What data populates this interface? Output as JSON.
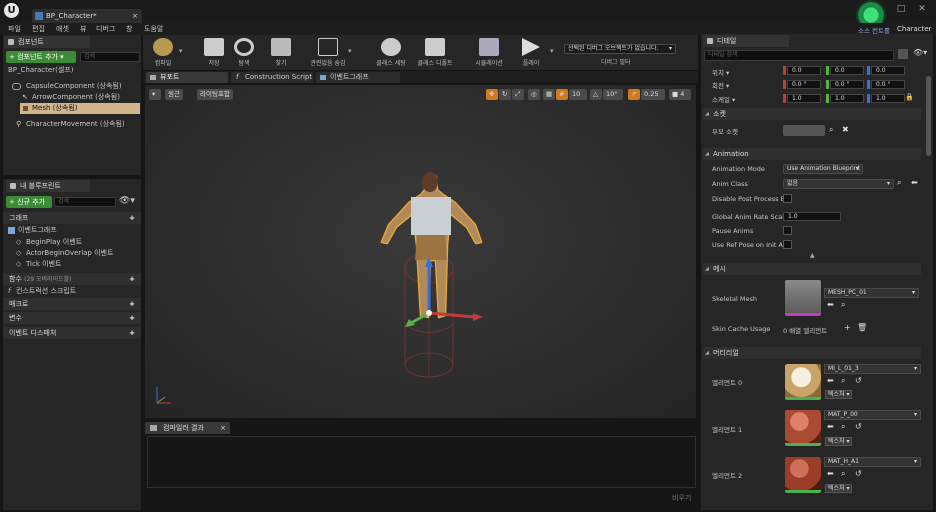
{
  "title_bar": {
    "doc_tab": "BP_Character*",
    "doc_tab_close": "×",
    "logo": "U",
    "source_control": "소스 컨트롤",
    "character": "Character"
  },
  "menu": [
    "파일",
    "편집",
    "애셋",
    "뷰",
    "디버그",
    "창",
    "도움말"
  ],
  "components": {
    "header": "컴포넌트",
    "add_button": "+ 컴포넌트 추가 ▾",
    "search_placeholder": "검색",
    "root": "BP_Character(셀프)",
    "items": [
      "CapsuleComponent (상속됨)",
      "ArrowComponent (상속됨)",
      "Mesh (상속됨)",
      "CharacterMovement (상속됨)"
    ]
  },
  "my_blueprint": {
    "header": "내 블루프린트",
    "add_button": "+ 신규 추가 ▾",
    "search_placeholder": "검색",
    "sections": {
      "graphs": "그래프",
      "event_graph": "이벤트그래프",
      "events": [
        "BeginPlay 이벤트",
        "ActorBeginOverlap 이벤트",
        "Tick 이벤트"
      ],
      "functions": "함수",
      "functions_count": "(29 오버라이드블)",
      "construction_script": "컨스트럭션 스크립트",
      "macros": "매크로",
      "variables": "변수",
      "event_dispatchers": "이벤트 디스패처"
    }
  },
  "toolbar": {
    "buttons": [
      "컴파일",
      "저장",
      "탐색",
      "찾기",
      "관련없음 숨김",
      "클래스 세팅",
      "클래스 디폴트",
      "시뮬레이션",
      "플레이"
    ],
    "debug_dropdown": "선택된 디버그 오브젝트가 없습니다.",
    "debug_filter": "디버그 필터"
  },
  "viewport_tabs": [
    "뷰포트",
    "Construction Script",
    "이벤트그래프"
  ],
  "viewport": {
    "perspective": "원근",
    "lighting": "라이팅포함",
    "grid_snap": "10",
    "rotation_snap": "10°",
    "scale_snap": "0.25",
    "camera_speed": "4"
  },
  "compiler": {
    "tab": "컴파일러 결과",
    "clear": "비우기"
  },
  "details": {
    "header": "디테일",
    "search_placeholder": "디테일 검색",
    "transform": {
      "location_label": "위치 ▾",
      "rotation_label": "회전 ▾",
      "scale_label": "스케일 ▾",
      "location": [
        "0.0",
        "0.0",
        "0.0"
      ],
      "rotation": [
        "0.0 °",
        "0.0 °",
        "0.0 °"
      ],
      "scale": [
        "1.0",
        "1.0",
        "1.0"
      ]
    },
    "sockets": {
      "section": "소켓",
      "parent_socket": "부모 소켓"
    },
    "animation": {
      "section": "Animation",
      "mode_label": "Animation Mode",
      "mode_value": "Use Animation Blueprint",
      "class_label": "Anim Class",
      "class_value": "없음",
      "disable_post_process": "Disable Post Process Bl",
      "global_rate_label": "Global Anim Rate Scale",
      "global_rate_value": "1.0",
      "pause_anims": "Pause Anims",
      "use_ref_pose": "Use Ref Pose on Init Ani"
    },
    "mesh": {
      "section": "메시",
      "skeletal_mesh_label": "Skeletal Mesh",
      "skeletal_mesh_value": "MESH_PC_01",
      "skin_cache_label": "Skin Cache Usage",
      "skin_cache_value": "0 배열 엘리먼트"
    },
    "materials": {
      "section": "머티리얼",
      "items": [
        {
          "label": "엘리먼트 0",
          "asset": "MI_L_01_3",
          "tag": "텍스처 ▾"
        },
        {
          "label": "엘리먼트 1",
          "asset": "MAT_P_00",
          "tag": "텍스처 ▾"
        },
        {
          "label": "엘리먼트 2",
          "asset": "MAT_H_A1",
          "tag": "텍스처 ▾"
        }
      ]
    }
  },
  "colors": {
    "accent_green": "#3d8b34",
    "selection": "#d1b48a",
    "axis_x": "#c23b3b",
    "axis_y": "#5bb04a",
    "axis_z": "#3a6fd8"
  }
}
